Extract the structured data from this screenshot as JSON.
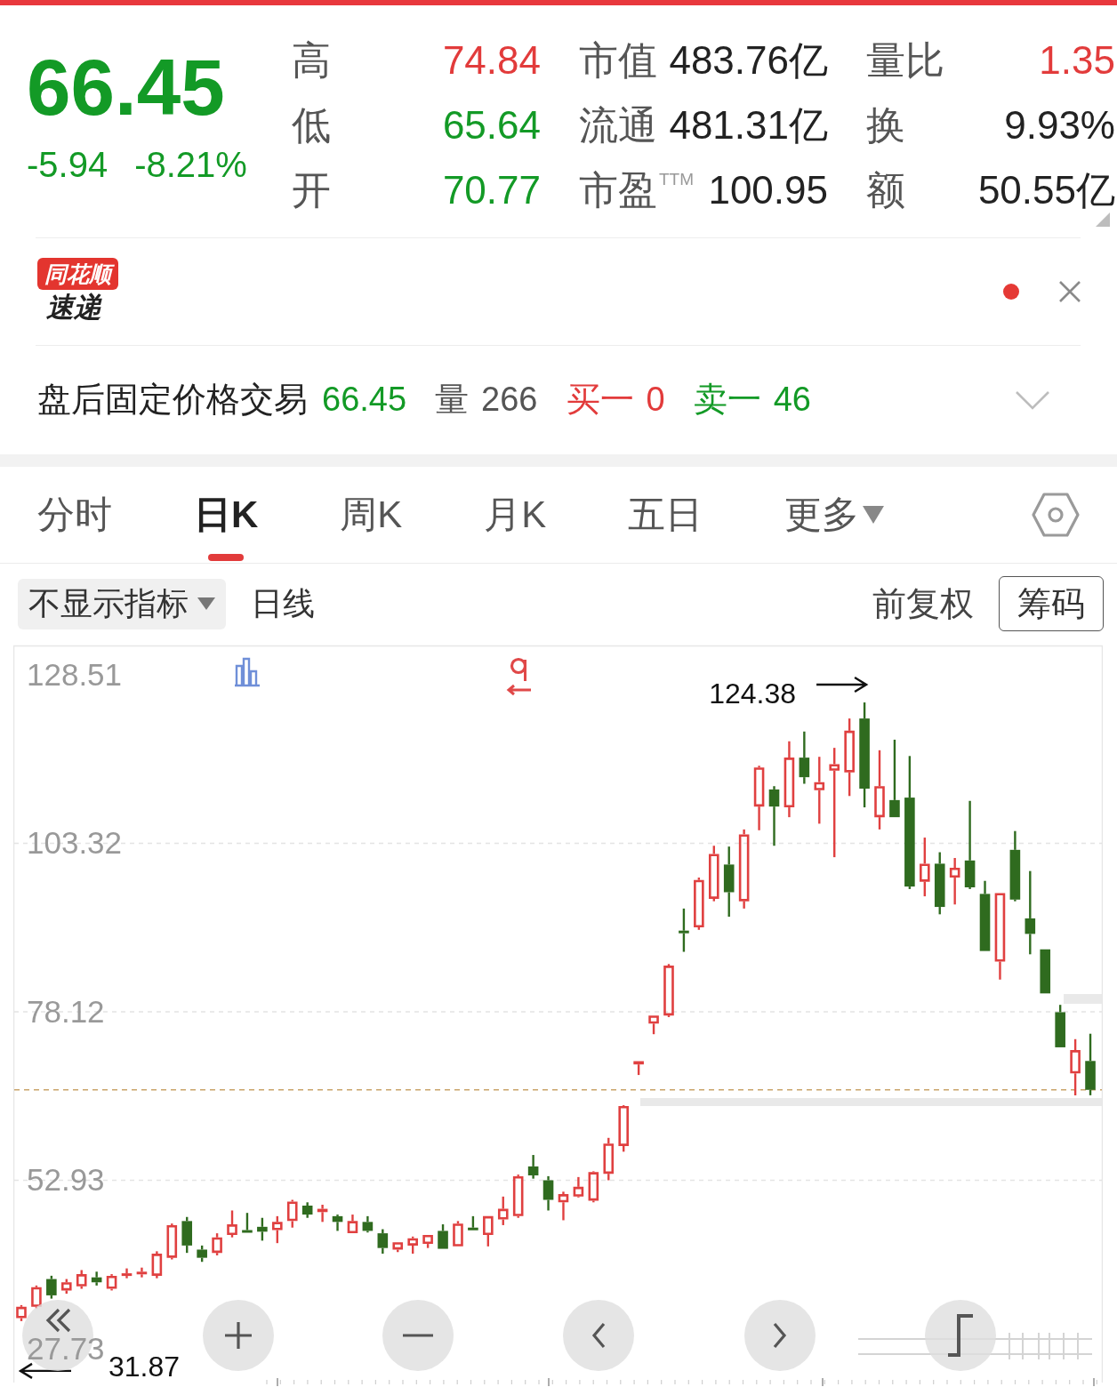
{
  "header": {
    "price": "66.45",
    "change": "-5.94",
    "change_percent": "-8.21%",
    "color": "#139a26"
  },
  "stats": [
    [
      {
        "label": "高",
        "value": "74.84",
        "color": "#e23b3b"
      },
      {
        "label": "低",
        "value": "65.64",
        "color": "#139a26"
      },
      {
        "label": "开",
        "value": "70.77",
        "color": "#139a26"
      }
    ],
    [
      {
        "label": "市值",
        "value": "483.76亿",
        "color": "#222222"
      },
      {
        "label": "流通",
        "value": "481.31亿",
        "color": "#222222"
      },
      {
        "label": "市盈$^{TTM}$",
        "value": "100.95",
        "color": "#222222"
      }
    ],
    [
      {
        "label": "量比",
        "value": "1.35",
        "color": "#e23b3b"
      },
      {
        "label": "换",
        "value": "9.93%",
        "color": "#222222"
      },
      {
        "label": "额",
        "value": "50.55亿",
        "color": "#222222"
      }
    ]
  ],
  "news_banner": {
    "logo_tag": "同花顺",
    "logo_name": "速递",
    "unread": true
  },
  "after_hours": {
    "title": "盘后固定价格交易",
    "items": [
      {
        "kind": "price",
        "value": "66.45"
      },
      {
        "kind": "volume",
        "label": "量",
        "value": "266"
      },
      {
        "kind": "bid",
        "label": "买一",
        "value": "0"
      },
      {
        "kind": "ask",
        "label": "卖一",
        "value": "46"
      }
    ],
    "expanded": false
  },
  "tabs": [
    {
      "label": "分时",
      "kind": "tab",
      "selected": false
    },
    {
      "label": "日K",
      "kind": "tab",
      "selected": true
    },
    {
      "label": "周K",
      "kind": "tab",
      "selected": false
    },
    {
      "label": "月K",
      "kind": "tab",
      "selected": false
    },
    {
      "label": "五日",
      "kind": "tab",
      "selected": false
    },
    {
      "label": "更多",
      "kind": "dropdown",
      "selected": false
    }
  ],
  "toolbar": {
    "indicator": "不显示指标",
    "period": "日线",
    "adjustment": "前复权",
    "chips_button": "筹码"
  },
  "chart": {
    "chart_data": {
      "type": "candlestick",
      "ohlc": [
        [
          32.31,
          34.26,
          31.87,
          34.01
        ],
        [
          34.01,
          37.19,
          33.77,
          36.94
        ],
        [
          38.16,
          38.65,
          35.23,
          35.72
        ],
        [
          36.45,
          38.16,
          35.97,
          37.67
        ],
        [
          37.06,
          39.5,
          36.7,
          38.89
        ],
        [
          38.41,
          39.26,
          37.19,
          37.67
        ],
        [
          36.7,
          38.89,
          36.45,
          38.65
        ],
        [
          38.77,
          39.75,
          38.28,
          39.02
        ],
        [
          38.89,
          39.87,
          38.41,
          39.26
        ],
        [
          38.65,
          42.31,
          38.28,
          41.95
        ],
        [
          41.34,
          46.46,
          41.09,
          46.22
        ],
        [
          46.83,
          47.44,
          42.07,
          43.17
        ],
        [
          42.56,
          43.17,
          40.73,
          41.34
        ],
        [
          42.07,
          45.0,
          41.7,
          44.39
        ],
        [
          44.75,
          48.41,
          44.39,
          46.34
        ],
        [
          45.48,
          48.05,
          45.12,
          45.12
        ],
        [
          45.97,
          47.31,
          43.9,
          45.24
        ],
        [
          45.48,
          47.56,
          43.53,
          46.7
        ],
        [
          46.83,
          50.0,
          45.85,
          49.75
        ],
        [
          49.14,
          49.63,
          47.31,
          47.8
        ],
        [
          48.17,
          49.27,
          46.7,
          48.66
        ],
        [
          47.56,
          47.8,
          45.36,
          46.7
        ],
        [
          45.0,
          47.8,
          45.0,
          46.83
        ],
        [
          46.7,
          47.56,
          45.12,
          45.36
        ],
        [
          45.0,
          45.61,
          41.95,
          42.8
        ],
        [
          42.56,
          43.65,
          42.19,
          43.65
        ],
        [
          43.17,
          44.51,
          41.95,
          44.26
        ],
        [
          43.41,
          44.75,
          42.8,
          44.75
        ],
        [
          45.36,
          46.34,
          42.68,
          42.68
        ],
        [
          43.04,
          46.83,
          43.04,
          46.46
        ],
        [
          45.85,
          47.56,
          45.48,
          45.61
        ],
        [
          44.75,
          47.56,
          43.04,
          47.56
        ],
        [
          47.07,
          50.49,
          46.22,
          48.66
        ],
        [
          47.56,
          53.78,
          47.31,
          53.54
        ],
        [
          55.0,
          56.71,
          53.17,
          53.66
        ],
        [
          52.93,
          53.54,
          48.41,
          50.0
        ],
        [
          49.63,
          51.22,
          46.95,
          50.85
        ],
        [
          50.49,
          53.41,
          50.36,
          51.95
        ],
        [
          49.88,
          54.27,
          49.63,
          54.15
        ],
        [
          53.9,
          59.27,
          52.93,
          58.42
        ],
        [
          58.05,
          64.15,
          57.2,
          64.03
        ],
        [
          70.25,
          70.74,
          68.67,
          70.74
        ],
        [
          76.35,
          77.57,
          74.77,
          77.57
        ],
        [
          77.57,
          85.26,
          77.33,
          85.02
        ],
        [
          90.26,
          93.56,
          87.09,
          89.9
        ],
        [
          90.75,
          98.19,
          90.38,
          97.83
        ],
        [
          95.02,
          102.95,
          94.65,
          101.73
        ],
        [
          100.14,
          102.83,
          92.34,
          96.0
        ],
        [
          94.65,
          105.39,
          93.56,
          104.66
        ],
        [
          108.81,
          114.91,
          105.27,
          114.66
        ],
        [
          111.37,
          111.86,
          102.95,
          108.81
        ],
        [
          108.69,
          118.57,
          107.22,
          116.13
        ],
        [
          116.13,
          120.03,
          112.22,
          113.2
        ],
        [
          111.25,
          116.25,
          106.25,
          112.47
        ],
        [
          114.18,
          117.59,
          101.24,
          115.15
        ],
        [
          113.93,
          121.98,
          110.39,
          120.15
        ],
        [
          121.98,
          124.38,
          108.69,
          111.49
        ],
        [
          107.22,
          117.23,
          105.39,
          111.86
        ],
        [
          109.78,
          118.81,
          107.22,
          107.22
        ],
        [
          110.15,
          116.37,
          96.48,
          96.85
        ],
        [
          97.58,
          104.17,
          95.39,
          100.27
        ],
        [
          100.27,
          101.98,
          92.7,
          93.8
        ],
        [
          98.19,
          101.12,
          94.17,
          99.66
        ],
        [
          100.75,
          109.66,
          96.48,
          96.73
        ],
        [
          95.75,
          97.7,
          87.21,
          87.21
        ],
        [
          85.63,
          95.87,
          82.94,
          95.87
        ],
        [
          102.34,
          105.15,
          94.65,
          94.9
        ],
        [
          92.09,
          99.17,
          86.72,
          89.77
        ],
        [
          87.46,
          87.46,
          80.87,
          80.87
        ],
        [
          78.06,
          79.16,
          72.81,
          72.81
        ],
        [
          68.91,
          74.03,
          65.62,
          72.39
        ],
        [
          70.77,
          74.84,
          65.64,
          66.45
        ]
      ],
      "ylim": [
        22.68,
        132.83
      ],
      "yticks": [
        128.51,
        103.32,
        78.12,
        52.93,
        27.73
      ],
      "grid": true,
      "ref_lines": [
        {
          "axis": "y",
          "value": 66.45
        }
      ],
      "annotations": [
        "124.38",
        "31.87"
      ]
    }
  }
}
